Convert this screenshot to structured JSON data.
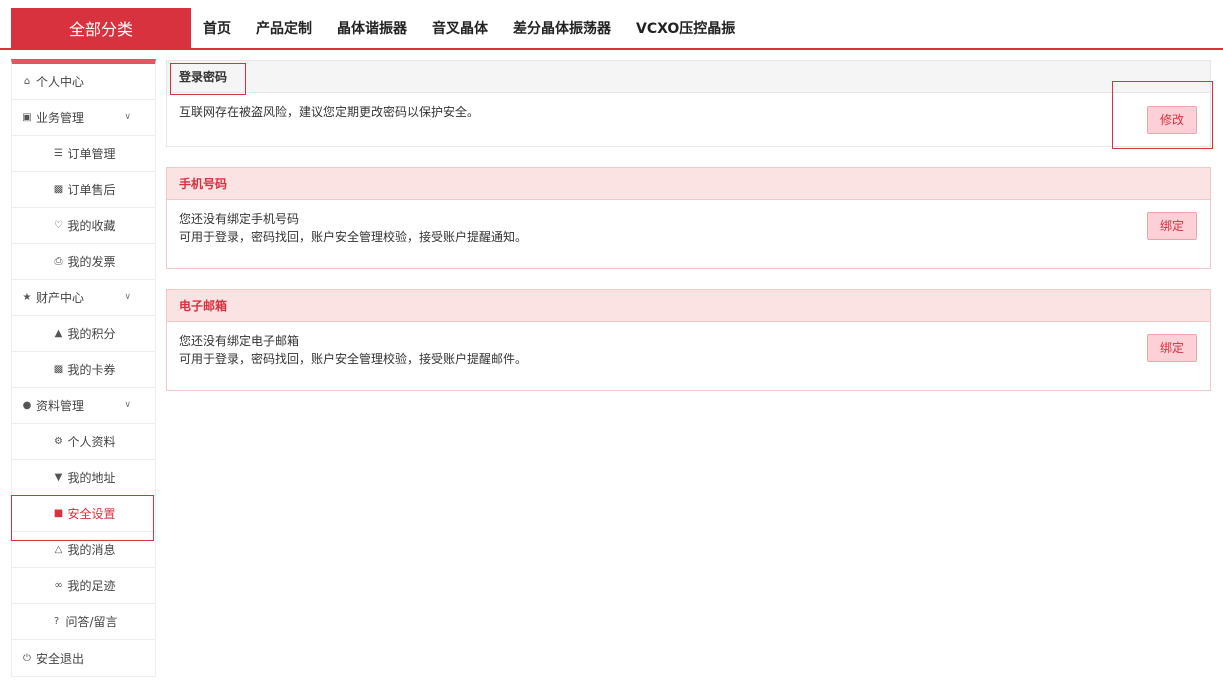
{
  "header": {
    "all_categories": "全部分类",
    "nav": [
      "首页",
      "产品定制",
      "晶体谐振器",
      "音叉晶体",
      "差分晶体振荡器",
      "VCXO压控晶振"
    ]
  },
  "sidebar": {
    "items": [
      {
        "label": "个人中心",
        "icon": "home-icon"
      },
      {
        "label": "业务管理",
        "icon": "cube-icon"
      },
      {
        "label": "订单管理",
        "icon": "list-icon"
      },
      {
        "label": "订单售后",
        "icon": "puzzle-icon"
      },
      {
        "label": "我的收藏",
        "icon": "heart-icon"
      },
      {
        "label": "我的发票",
        "icon": "print-icon"
      },
      {
        "label": "财产中心",
        "icon": "trophy-icon"
      },
      {
        "label": "我的积分",
        "icon": "fire-icon"
      },
      {
        "label": "我的卡券",
        "icon": "gift-icon"
      },
      {
        "label": "资料管理",
        "icon": "user-icon"
      },
      {
        "label": "个人资料",
        "icon": "gear-icon"
      },
      {
        "label": "我的地址",
        "icon": "pin-icon"
      },
      {
        "label": "安全设置",
        "icon": "lock-icon"
      },
      {
        "label": "我的消息",
        "icon": "bell-icon"
      },
      {
        "label": "我的足迹",
        "icon": "footprint-icon"
      },
      {
        "label": "问答/留言",
        "icon": "question-icon"
      },
      {
        "label": "安全退出",
        "icon": "power-icon"
      }
    ]
  },
  "panels": {
    "password": {
      "title": "登录密码",
      "desc": "互联网存在被盗风险，建议您定期更改密码以保护安全。",
      "button": "修改"
    },
    "phone": {
      "title": "手机号码",
      "line1": "您还没有绑定手机号码",
      "line2": "可用于登录，密码找回，账户安全管理校验，接受账户提醒通知。",
      "button": "绑定"
    },
    "email": {
      "title": "电子邮箱",
      "line1": "您还没有绑定电子邮箱",
      "line2": "可用于登录，密码找回，账户安全管理校验，接受账户提醒邮件。",
      "button": "绑定"
    }
  }
}
